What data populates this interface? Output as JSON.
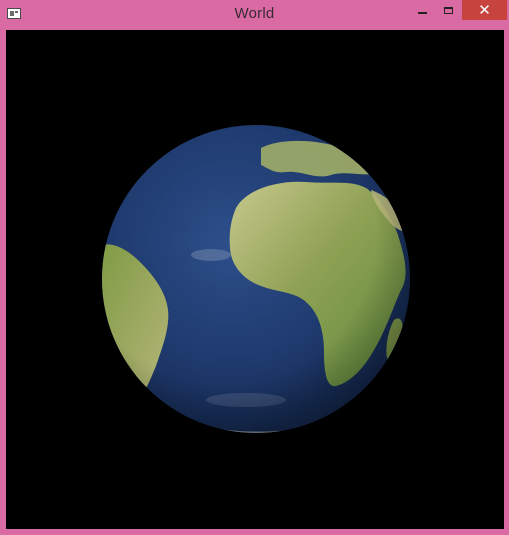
{
  "window": {
    "title": "World",
    "close_glyph": "✕",
    "app_icon": "window-app-icon",
    "controls": [
      "minimize-icon",
      "maximize-icon",
      "close-icon"
    ]
  },
  "viewport": {
    "background": "#000000",
    "content": "earth-globe"
  },
  "colors": {
    "titlebar": "#d96aa4",
    "close_button": "#c7443e",
    "ocean": "#1f3a6e",
    "land": "#8a9e55"
  }
}
